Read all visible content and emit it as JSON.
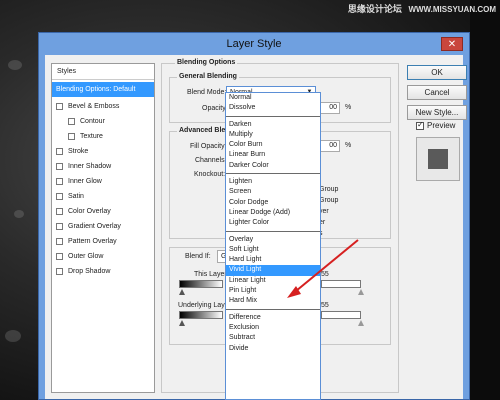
{
  "watermark": {
    "text": "思缘设计论坛",
    "url": "WWW.MISSYUAN.COM"
  },
  "dialog": {
    "title": "Layer Style",
    "close_label": "✕"
  },
  "styles_panel": {
    "header": "Styles",
    "items": [
      {
        "label": "Blending Options: Default",
        "checkbox": false,
        "selected": true
      },
      {
        "label": "Bevel & Emboss",
        "checkbox": true
      },
      {
        "label": "Contour",
        "checkbox": true,
        "sub": true
      },
      {
        "label": "Texture",
        "checkbox": true,
        "sub": true
      },
      {
        "label": "Stroke",
        "checkbox": true
      },
      {
        "label": "Inner Shadow",
        "checkbox": true
      },
      {
        "label": "Inner Glow",
        "checkbox": true
      },
      {
        "label": "Satin",
        "checkbox": true
      },
      {
        "label": "Color Overlay",
        "checkbox": true
      },
      {
        "label": "Gradient Overlay",
        "checkbox": true
      },
      {
        "label": "Pattern Overlay",
        "checkbox": true
      },
      {
        "label": "Outer Glow",
        "checkbox": true
      },
      {
        "label": "Drop Shadow",
        "checkbox": true
      }
    ]
  },
  "blending": {
    "section_title": "Blending Options",
    "general_title": "General Blending",
    "blend_mode_label": "Blend Mode:",
    "blend_mode_value": "Normal",
    "opacity_label": "Opacity:",
    "opacity_value": "00",
    "opacity_unit": "%",
    "advanced_title": "Advanced Blen",
    "fill_opacity_label": "Fill Opacity:",
    "fill_opacity_value": "00",
    "fill_unit": "%",
    "channels_label": "Channels:",
    "knockout_label": "Knockout:",
    "adv_partials": [
      "Group",
      "Group",
      "yer",
      "er",
      "s"
    ],
    "blend_if_label": "Blend If:",
    "blend_if_value": "Gra",
    "this_layer_label": "This Layer:",
    "this_layer_value": "55",
    "underlying_label": "Underlying Layer:",
    "underlying_value": "55"
  },
  "dropdown": {
    "groups": [
      [
        "Normal",
        "Dissolve"
      ],
      [
        "Darken",
        "Multiply",
        "Color Burn",
        "Linear Burn",
        "Darker Color"
      ],
      [
        "Lighten",
        "Screen",
        "Color Dodge",
        "Linear Dodge (Add)",
        "Lighter Color"
      ],
      [
        "Overlay",
        "Soft Light",
        "Hard Light",
        "Vivid Light",
        "Linear Light",
        "Pin Light",
        "Hard Mix"
      ],
      [
        "Difference",
        "Exclusion",
        "Subtract",
        "Divide"
      ]
    ],
    "highlighted": "Vivid Light"
  },
  "buttons": {
    "ok": "OK",
    "cancel": "Cancel",
    "new_style": "New Style...",
    "preview": "Preview",
    "preview_checked": "✓"
  },
  "colors": {
    "accent": "#3399ff",
    "arrow": "#d62020",
    "title_bar": "#6fa0e0"
  }
}
